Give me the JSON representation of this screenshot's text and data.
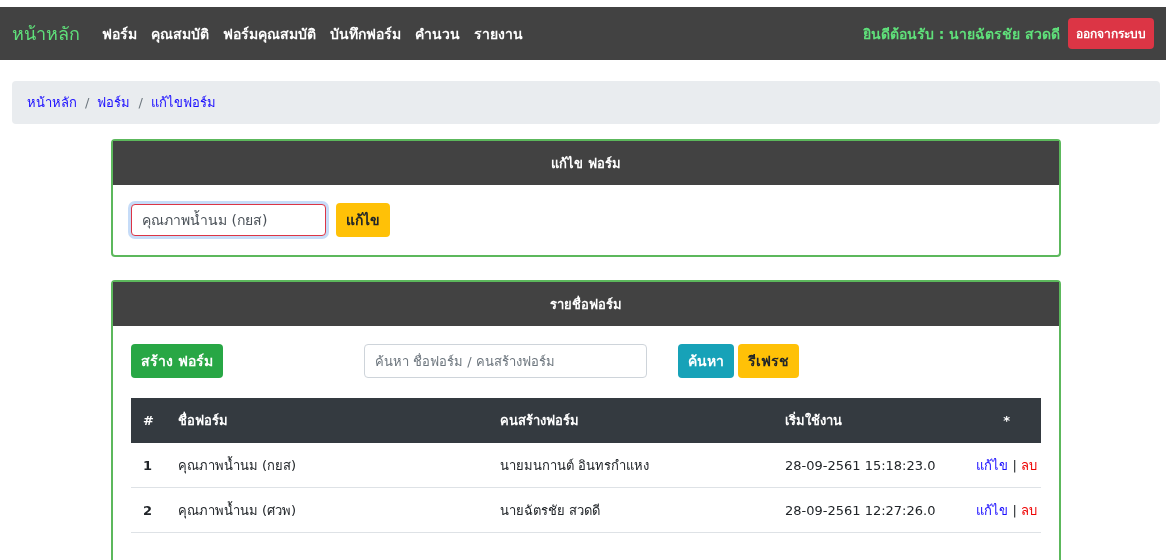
{
  "navbar": {
    "brand": "หน้าหลัก",
    "items": [
      {
        "label": "ฟอร์ม"
      },
      {
        "label": "คุณสมบัติ"
      },
      {
        "label": "ฟอร์มคุณสมบัติ"
      },
      {
        "label": "บันทึกฟอร์ม"
      },
      {
        "label": "คำนวน"
      },
      {
        "label": "รายงาน"
      }
    ],
    "welcome": "ยินดีต้อนรับ : นายฉัตรชัย สวดดี",
    "logout": "ออกจากระบบ"
  },
  "breadcrumb": {
    "items": [
      "หน้าหลัก",
      "ฟอร์ม",
      "แก้ไขฟอร์ม"
    ],
    "separator": "/"
  },
  "edit_card": {
    "title": "แก้ไข ฟอร์ม",
    "field": {
      "value": "คุณภาพน้ำนม (กยส)",
      "invalid": true
    },
    "button": "แก้ไข"
  },
  "list_card": {
    "title": "รายชื่อฟอร์ม",
    "create_button": "สร้าง ฟอร์ม",
    "search": {
      "placeholder": "ค้นหา ชื่อฟอร์ม / คนสร้างฟอร์ม"
    },
    "search_button": "ค้นหา",
    "refresh_button": "รีเฟรช",
    "table": {
      "columns": [
        "#",
        "ชื่อฟอร์ม",
        "คนสร้างฟอร์ม",
        "เริ่มใช้งาน",
        "*"
      ],
      "rows": [
        {
          "cells": [
            "1",
            "คุณภาพน้ำนม (กยส)",
            "นายมนกานต์ อินทรกำแหง",
            "28-09-2561 15:18:23.0"
          ],
          "edit": "แก้ไข",
          "divider": "|",
          "delete": "ลบ"
        },
        {
          "cells": [
            "2",
            "คุณภาพน้ำนม (ศวพ)",
            "นายฉัตรชัย สวดดี",
            "28-09-2561 12:27:26.0"
          ],
          "edit": "แก้ไข",
          "divider": "|",
          "delete": "ลบ"
        }
      ]
    }
  }
}
